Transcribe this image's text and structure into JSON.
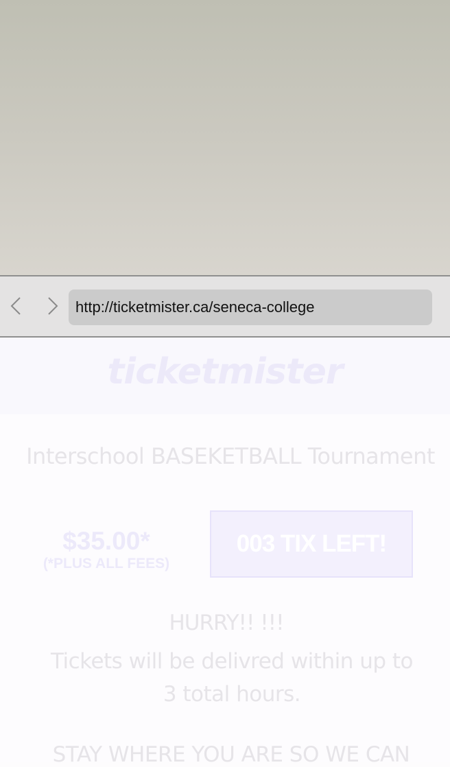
{
  "browser": {
    "url": "http://ticketmister.ca/seneca-college",
    "back_icon": "chevron-left-icon",
    "forward_icon": "chevron-right-icon"
  },
  "page": {
    "logo": "ticketmister",
    "event_title": "Interschool BASEKETBALL Tournament",
    "price": "$35.00*",
    "fees_note": "(*PLUS ALL FEES)",
    "tickets_left": "003 TIX LEFT!",
    "hurry": "HURRY!! !!!",
    "delivery_note": "Tickets will be delivred within up to 3 total hours.",
    "stay_text": "STAY WHERE YOU ARE SO WE CAN"
  },
  "colors": {
    "top_gradient_start": "#bfbfb3",
    "top_gradient_end": "#d8d5ce",
    "browser_bar": "#e4e3e3",
    "url_bar": "#cbcbcb",
    "page_background": "#fdfcfe",
    "faded_text": "#e6e4e8",
    "faded_accent": "#ece9fa"
  }
}
